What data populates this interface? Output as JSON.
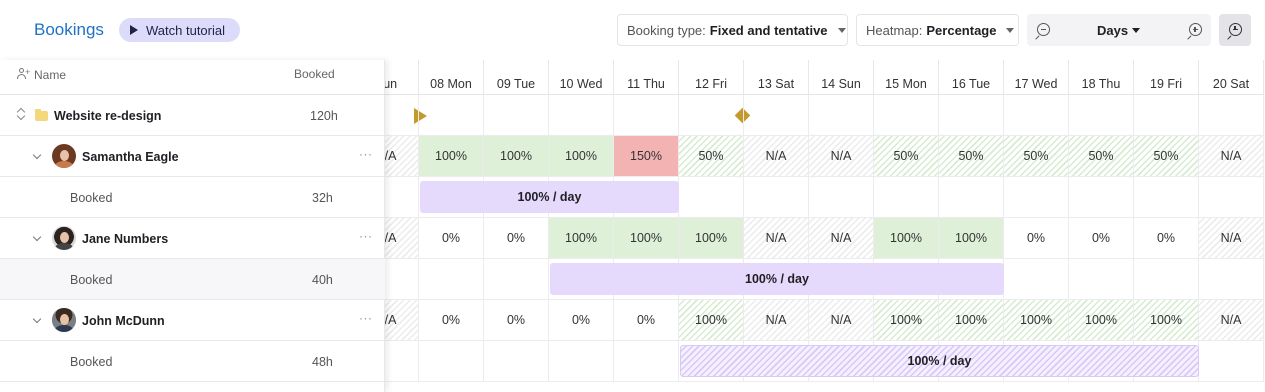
{
  "header": {
    "title": "Bookings",
    "tutorial_label": "Watch tutorial",
    "booking_type_label": "Booking type:",
    "booking_type_value": "Fixed and tentative",
    "heatmap_label": "Heatmap:",
    "heatmap_value": "Percentage",
    "zoom_label": "Days"
  },
  "list_header": {
    "name": "Name",
    "booked": "Booked"
  },
  "project": {
    "name": "Website re-design",
    "hours": "120h"
  },
  "people": [
    {
      "name": "Samantha Eagle",
      "booked_label": "Booked",
      "booked_hours": "32h",
      "hair": "#6b3a22",
      "shirt": "#c97a4a"
    },
    {
      "name": "Jane Numbers",
      "booked_label": "Booked",
      "booked_hours": "40h",
      "hair": "#2a2320",
      "shirt": "#444444"
    },
    {
      "name": "John McDunn",
      "booked_label": "Booked",
      "booked_hours": "48h",
      "hair": "#3a2b22",
      "shirt": "#2e3a4e"
    }
  ],
  "days": [
    "Sun",
    "08 Mon",
    "09 Tue",
    "10 Wed",
    "11 Thu",
    "12 Fri",
    "13 Sat",
    "14 Sun",
    "15 Mon",
    "16 Tue",
    "17 Wed",
    "18 Thu",
    "19 Fri",
    "20 Sat"
  ],
  "heatmap": [
    [
      [
        "N/A",
        "na"
      ],
      [
        "100%",
        "green"
      ],
      [
        "100%",
        "green"
      ],
      [
        "100%",
        "green"
      ],
      [
        "150%",
        "red"
      ],
      [
        "50%",
        "part"
      ],
      [
        "N/A",
        "na"
      ],
      [
        "N/A",
        "na"
      ],
      [
        "50%",
        "part"
      ],
      [
        "50%",
        "part"
      ],
      [
        "50%",
        "part"
      ],
      [
        "50%",
        "part"
      ],
      [
        "50%",
        "part"
      ],
      [
        "N/A",
        "na"
      ]
    ],
    [
      [
        "N/A",
        "na"
      ],
      [
        "0%",
        "plain"
      ],
      [
        "0%",
        "plain"
      ],
      [
        "100%",
        "green"
      ],
      [
        "100%",
        "green"
      ],
      [
        "100%",
        "green"
      ],
      [
        "N/A",
        "na"
      ],
      [
        "N/A",
        "na"
      ],
      [
        "100%",
        "green"
      ],
      [
        "100%",
        "green"
      ],
      [
        "0%",
        "plain"
      ],
      [
        "0%",
        "plain"
      ],
      [
        "0%",
        "plain"
      ],
      [
        "N/A",
        "na"
      ]
    ],
    [
      [
        "N/A",
        "na"
      ],
      [
        "0%",
        "plain"
      ],
      [
        "0%",
        "plain"
      ],
      [
        "0%",
        "plain"
      ],
      [
        "0%",
        "plain"
      ],
      [
        "100%",
        "part"
      ],
      [
        "N/A",
        "na"
      ],
      [
        "N/A",
        "na"
      ],
      [
        "100%",
        "part"
      ],
      [
        "100%",
        "part"
      ],
      [
        "100%",
        "part"
      ],
      [
        "100%",
        "part"
      ],
      [
        "100%",
        "part"
      ],
      [
        "N/A",
        "na"
      ]
    ]
  ],
  "bookings": [
    {
      "label": "100% / day",
      "start_day": "08 Mon",
      "end_day": "11 Thu",
      "kind": "fixed"
    },
    {
      "label": "100% / day",
      "start_day": "10 Wed",
      "end_day": "16 Tue",
      "kind": "fixed"
    },
    {
      "label": "100% / day",
      "start_day": "12 Fri",
      "end_day": "19 Fri",
      "kind": "tentative"
    }
  ],
  "colors": {
    "title": "#1f72c4",
    "green": "#dff0d9",
    "red": "#f4b3b3",
    "booking": "#e6dafc",
    "milestone": "#c49a2c"
  }
}
